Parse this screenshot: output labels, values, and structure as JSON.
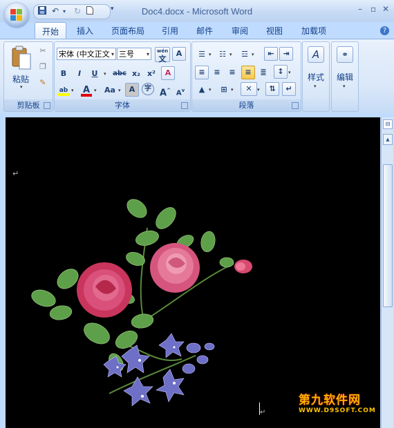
{
  "window": {
    "title": "Doc4.docx - Microsoft Word",
    "controls": {
      "minimize": "–",
      "restore": "▫",
      "close": "✕"
    }
  },
  "quick_access": {
    "save_icon": "save-icon",
    "undo_icon": "undo-icon",
    "redo_icon": "redo-icon",
    "new_icon": "new-document-icon",
    "more": "▾"
  },
  "tabs": [
    {
      "label": "开始",
      "active": true
    },
    {
      "label": "插入"
    },
    {
      "label": "页面布局"
    },
    {
      "label": "引用"
    },
    {
      "label": "邮件"
    },
    {
      "label": "审阅"
    },
    {
      "label": "视图"
    },
    {
      "label": "加载项"
    }
  ],
  "help": "?",
  "ribbon": {
    "clipboard": {
      "label": "剪贴板",
      "paste": "粘贴"
    },
    "font": {
      "label": "字体",
      "font_name": "宋体 (中文正文",
      "font_size": "三号",
      "phonetic": "wén",
      "phonetic_char": "文",
      "char_border": "A",
      "bold": "B",
      "italic": "I",
      "underline": "U",
      "strike": "abc",
      "sub": "x₂",
      "sup": "x²",
      "clear": "A",
      "font_color": "A",
      "change_case": "Aa",
      "shading": "A",
      "enclose": "字",
      "grow": "A",
      "shrink": "A"
    },
    "paragraph": {
      "label": "段落"
    },
    "styles": {
      "label": "样式"
    },
    "editing": {
      "label": "编辑"
    }
  },
  "colors": {
    "highlight": "#ffff00",
    "font_color": "#e00000",
    "page_background": "#000000"
  },
  "document": {
    "paragraph_mark": "↵",
    "image": "rose-bouquet-image"
  },
  "watermark": {
    "line1": "第九软件网",
    "line2": "WWW.D9SOFT.COM"
  }
}
